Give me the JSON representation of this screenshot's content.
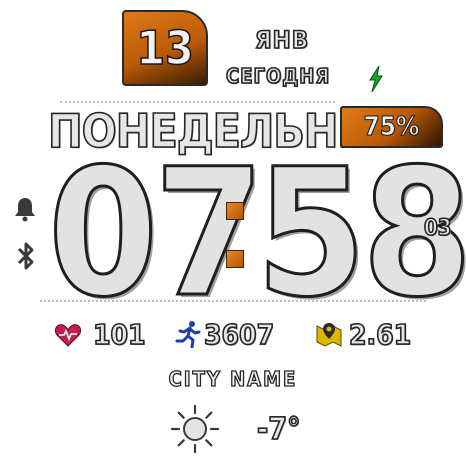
{
  "date": {
    "day": "13",
    "month": "ЯНВ",
    "today_label": "СЕГОДНЯ"
  },
  "weekday": "ПОНЕДЕЛЬНИК",
  "battery": {
    "percent_text": "75%",
    "charging_icon": "lightning-icon"
  },
  "time": {
    "hours": "07",
    "minutes": "58",
    "seconds": "03"
  },
  "status_icons": [
    "bell-icon",
    "bluetooth-icon"
  ],
  "stats": {
    "heart_rate": "101",
    "steps": "3607",
    "distance": "2.61"
  },
  "weather": {
    "city": "CITY NAME",
    "temperature": "-7°",
    "condition_icon": "sun-icon"
  },
  "colors": {
    "accent": "#c8660c",
    "charge": "#1aa32a",
    "heart": "#c0204a",
    "run": "#1f3fa8",
    "map": "#d8b800"
  }
}
